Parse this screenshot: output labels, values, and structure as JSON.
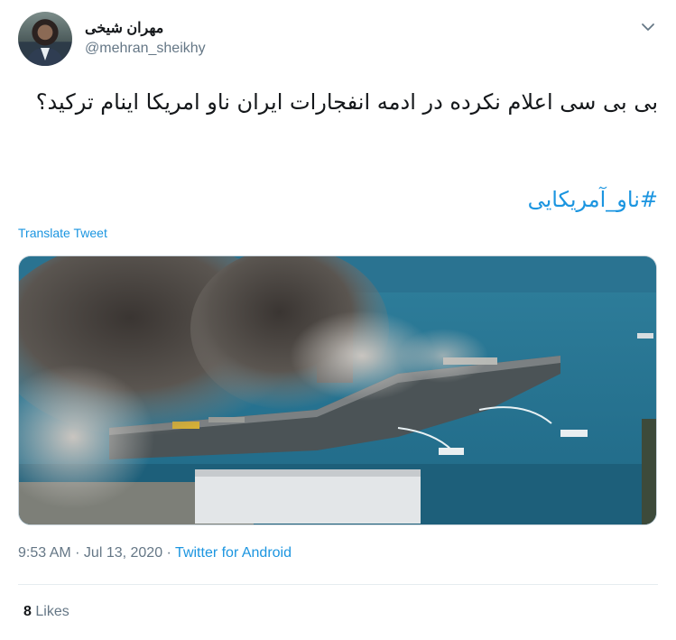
{
  "author": {
    "display_name": "مهران شیخی",
    "handle": "@mehran_sheikhy"
  },
  "tweet": {
    "text": "بی بی سی اعلام نکرده در ادمه انفجارات ایران ناو امریکا اینام ترکید؟",
    "hashtag": "#ناو_آمریکایی",
    "translate_label": "Translate Tweet"
  },
  "media": {
    "description_icon": "photo-of-burning-ship"
  },
  "meta": {
    "time": "9:53 AM",
    "sep1": " · ",
    "date": "Jul 13, 2020",
    "sep2": " · ",
    "source": "Twitter for Android"
  },
  "stats": {
    "likes_count": "8",
    "likes_label": "Likes"
  },
  "colors": {
    "link": "#1b95e0",
    "secondary_text": "#657786",
    "primary_text": "#14171a"
  }
}
